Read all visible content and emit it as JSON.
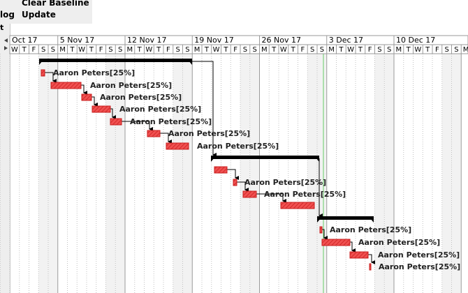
{
  "toolbar": {
    "left_partial_label": "log",
    "update_label": "Update",
    "clear_baseline_label": "Clear Baseline",
    "clear_baseline_line2": "Update"
  },
  "left_panel_text": "t",
  "timeline": {
    "weeks": [
      "Oct 17",
      "5 Nov 17",
      "12 Nov 17",
      "19 Nov 17",
      "26 Nov 17",
      "3 Dec 17",
      "10 Dec 17"
    ],
    "day_letters": [
      "M",
      "T",
      "W",
      "T",
      "F",
      "S",
      "S"
    ]
  },
  "colors": {
    "task_fill": "#f05050",
    "task_hatch": "#c81e1e",
    "summary": "#000000",
    "today_line": "#66cc66",
    "grid": "#c0c0c0",
    "weekend": "#f2f2f2"
  },
  "tasks": [
    {
      "label": "Aaron Peters[25%]"
    },
    {
      "label": "Aaron Peters[25%]"
    },
    {
      "label": "Aaron Peters[25%]"
    },
    {
      "label": "Aaron Peters[25%]"
    },
    {
      "label": "Aaron Peters[25%]"
    },
    {
      "label": "Aaron Peters[25%]"
    },
    {
      "label": "Aaron Peters[25%]"
    },
    {
      "label": "Aaron Peters[25%]"
    },
    {
      "label": "Aaron Peters[25%]"
    },
    {
      "label": "Aaron Peters[25%]"
    },
    {
      "label": "Aaron Peters[25%]"
    },
    {
      "label": "Aaron Peters[25%]"
    },
    {
      "label": "Aaron Peters[25%]"
    },
    {
      "label": "Aaron Peters[25%]"
    }
  ]
}
